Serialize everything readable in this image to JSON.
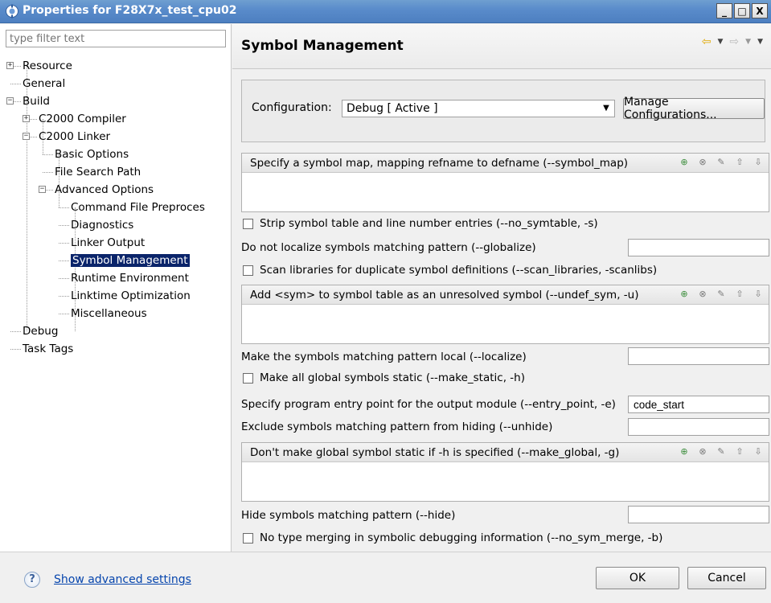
{
  "window": {
    "title": "Properties for F28X7x_test_cpu02",
    "controls": {
      "minimize": "_",
      "maximize": "□",
      "close": "X"
    }
  },
  "sidebar": {
    "filter_placeholder": "type filter text",
    "tree": [
      {
        "label": "Resource",
        "level": 0,
        "expander": "+"
      },
      {
        "label": "General",
        "level": 0
      },
      {
        "label": "Build",
        "level": 0,
        "expander": "-"
      },
      {
        "label": "C2000 Compiler",
        "level": 1,
        "expander": "+"
      },
      {
        "label": "C2000 Linker",
        "level": 1,
        "expander": "-"
      },
      {
        "label": "Basic Options",
        "level": 2
      },
      {
        "label": "File Search Path",
        "level": 2
      },
      {
        "label": "Advanced Options",
        "level": 2,
        "expander": "-"
      },
      {
        "label": "Command File Preproces",
        "level": 3
      },
      {
        "label": "Diagnostics",
        "level": 3
      },
      {
        "label": "Linker Output",
        "level": 3
      },
      {
        "label": "Symbol Management",
        "level": 3,
        "selected": true
      },
      {
        "label": "Runtime Environment",
        "level": 3
      },
      {
        "label": "Linktime Optimization",
        "level": 3
      },
      {
        "label": "Miscellaneous",
        "level": 3
      },
      {
        "label": "Debug",
        "level": 0
      },
      {
        "label": "Task Tags",
        "level": 0
      }
    ]
  },
  "header": {
    "title": "Symbol Management"
  },
  "config": {
    "label": "Configuration:",
    "value": "Debug  [ Active ]",
    "manage_button": "Manage Configurations..."
  },
  "options": {
    "symbol_map": "Specify a symbol map, mapping refname to defname (--symbol_map)",
    "no_symtable": "Strip symbol table and line number entries (--no_symtable, -s)",
    "globalize": "Do not localize symbols matching pattern (--globalize)",
    "scan_libraries": "Scan libraries for duplicate symbol definitions (--scan_libraries, -scanlibs)",
    "undef_sym": "Add <sym> to symbol table as an unresolved symbol (--undef_sym, -u)",
    "localize": "Make the symbols matching pattern local (--localize)",
    "make_static": "Make all global symbols static (--make_static, -h)",
    "entry_point": "Specify program entry point for the output module (--entry_point, -e)",
    "entry_point_value": "code_start",
    "unhide": "Exclude symbols matching pattern from hiding (--unhide)",
    "make_global": "Don't make global symbol static if -h is specified (--make_global, -g)",
    "hide": "Hide symbols matching pattern (--hide)",
    "no_sym_merge": "No type merging in symbolic debugging information (--no_sym_merge, -b)"
  },
  "footer": {
    "help_icon": "?",
    "advanced_link": "Show advanced settings",
    "ok": "OK",
    "cancel": "Cancel"
  }
}
